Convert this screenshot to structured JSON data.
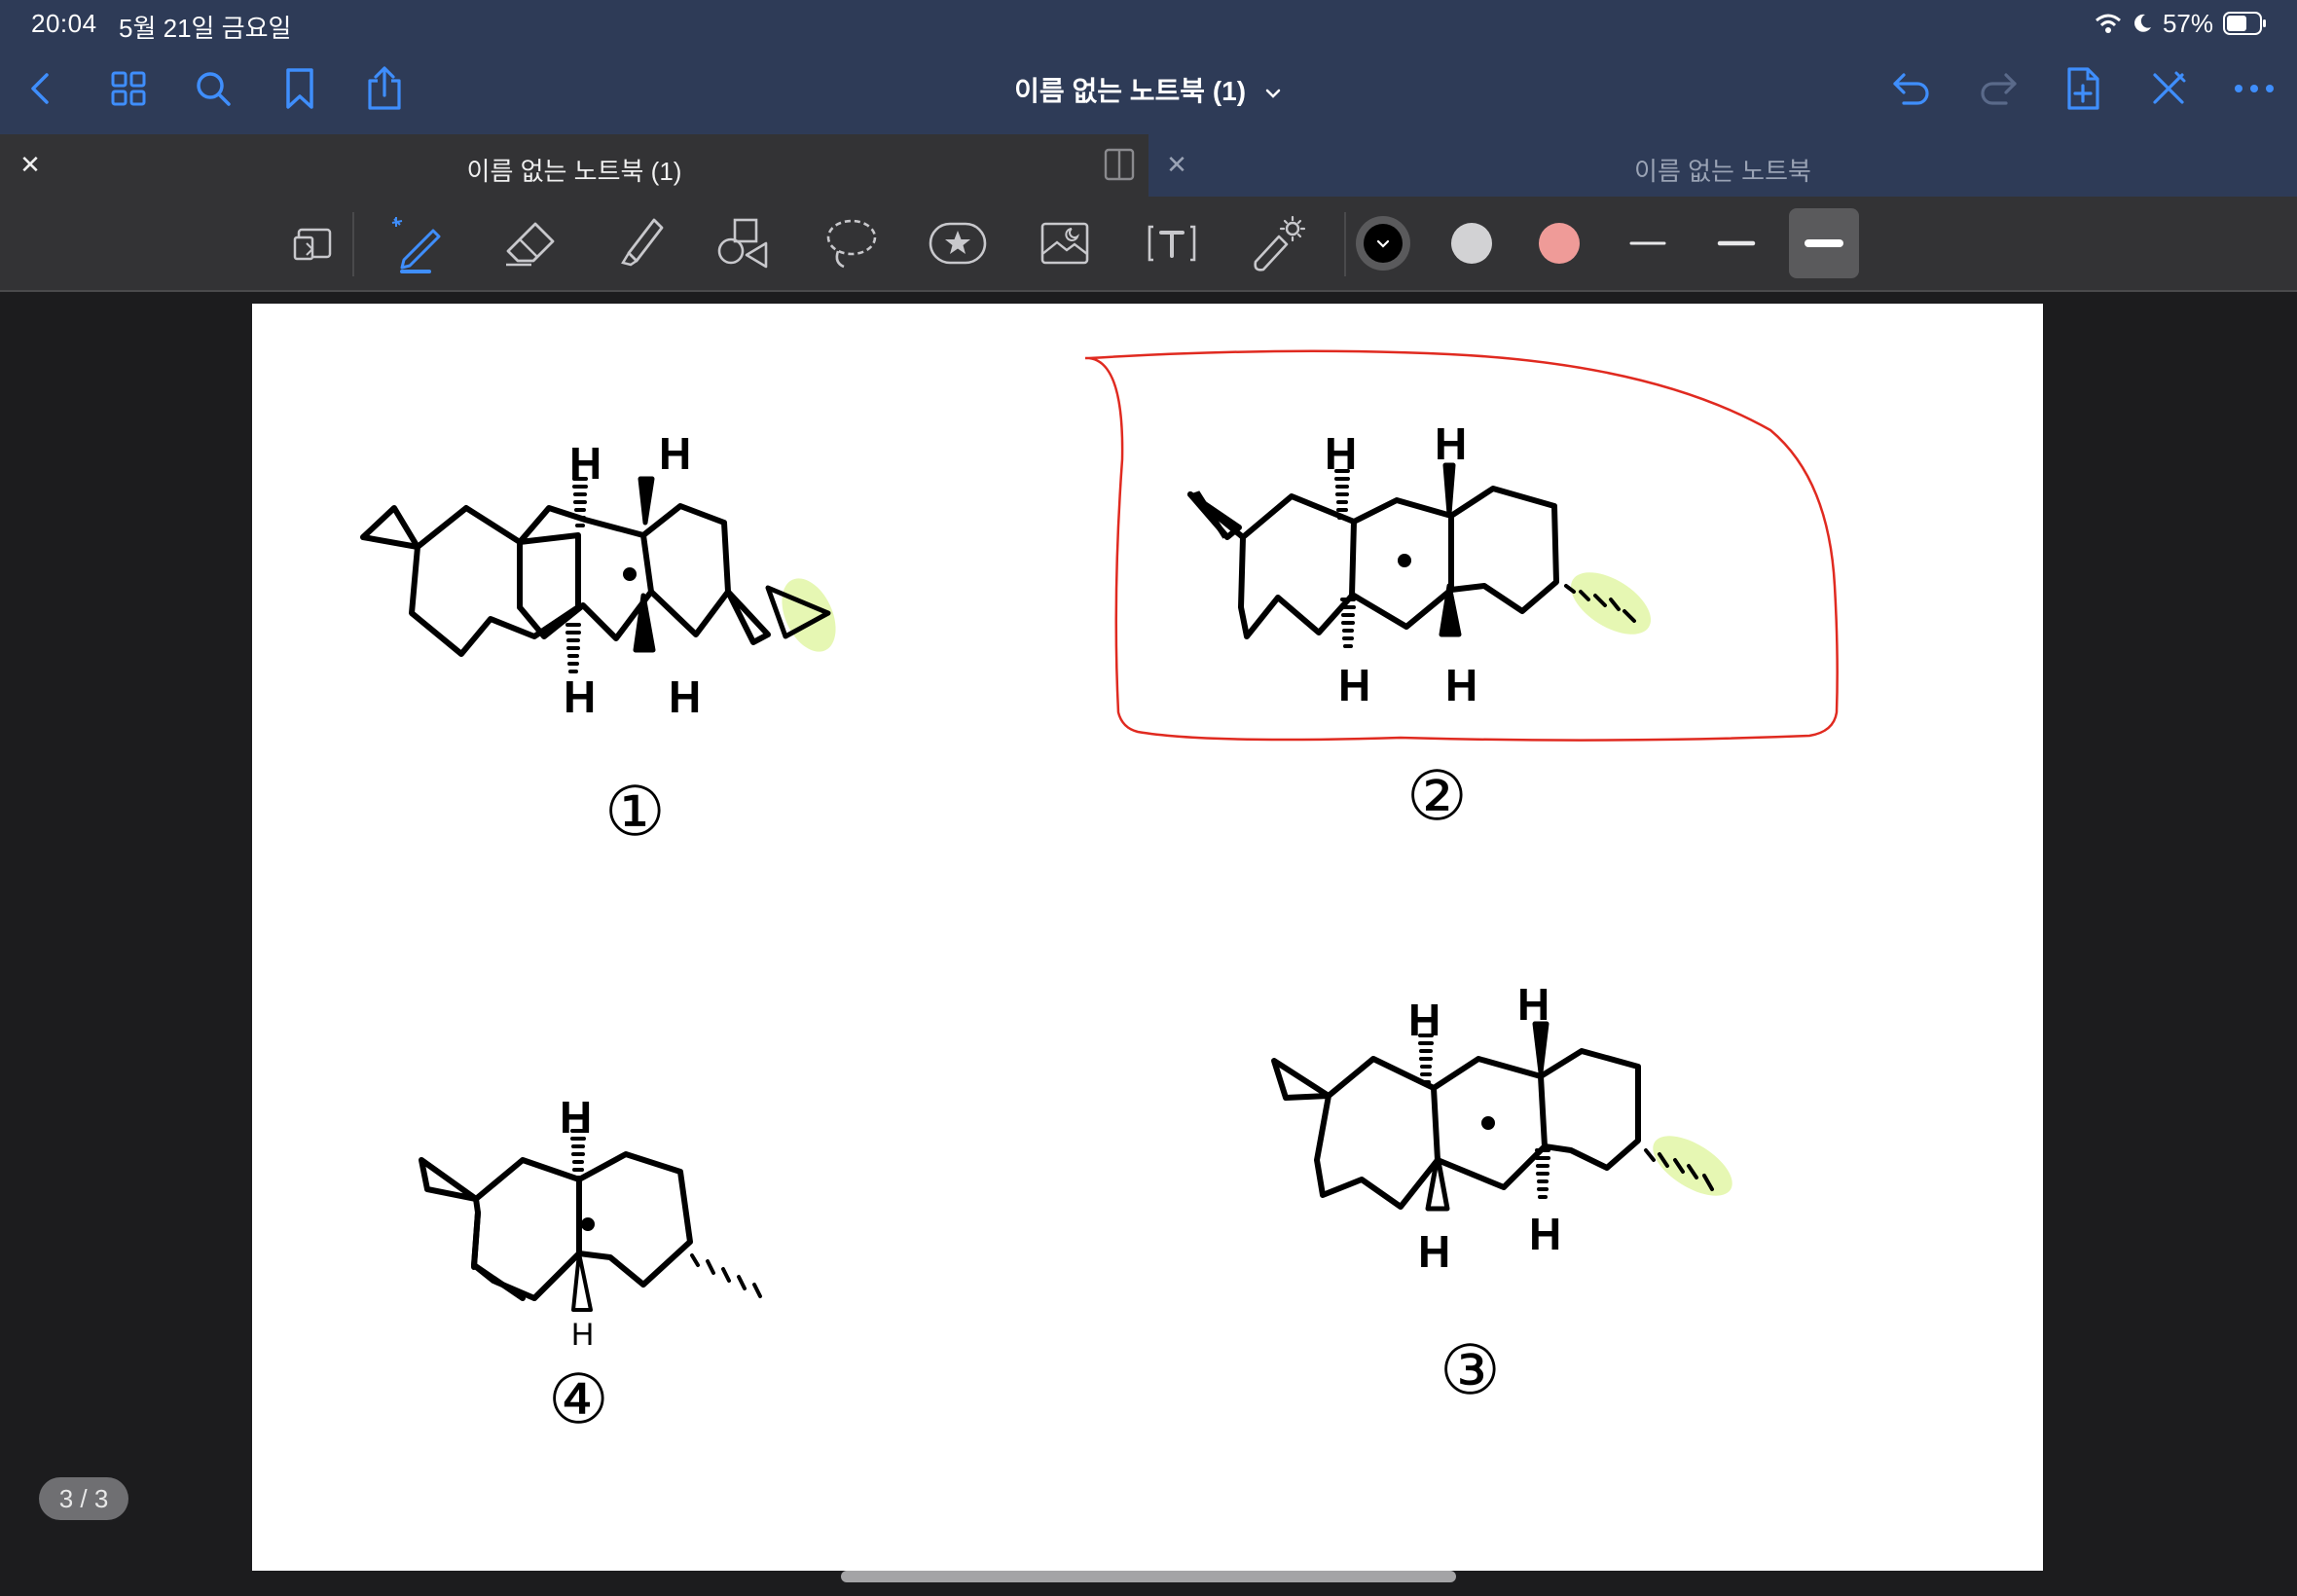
{
  "status_bar": {
    "time": "20:04",
    "date": "5월 21일 금요일",
    "battery": "57%"
  },
  "nav": {
    "title": "이름 없는 노트북 (1)",
    "left_icons": [
      "back-icon",
      "grid-icon",
      "search-icon",
      "bookmark-icon",
      "share-icon"
    ],
    "right_icons": [
      "undo-icon",
      "redo-icon",
      "add-page-icon",
      "close-pen-icon",
      "more-icon"
    ]
  },
  "tabs": [
    {
      "label": "이름 없는 노트북 (1)",
      "active": true
    },
    {
      "label": "이름 없는 노트북",
      "active": false
    }
  ],
  "toolbar": {
    "tools": [
      "page-switch-icon",
      "pen-icon",
      "eraser-icon",
      "highlighter-icon",
      "shapes-icon",
      "lasso-icon",
      "sticker-icon",
      "image-icon",
      "text-icon",
      "laser-pointer-icon"
    ],
    "colors": [
      "#000000",
      "#d2d2d4",
      "#ef9b98"
    ],
    "active_tool": "pen-icon"
  },
  "page_indicator": "3 / 3",
  "page": {
    "molecule_1_hydrogens": [
      "H",
      "H",
      "H",
      "H"
    ],
    "molecule_2_hydrogens": [
      "H",
      "H",
      "H",
      "H"
    ],
    "molecule_3_hydrogens": [
      "H",
      "H",
      "H",
      "H"
    ],
    "molecule_4_hydrogens": [
      "H",
      "H"
    ],
    "labels": [
      "①",
      "②",
      "③",
      "④"
    ]
  },
  "accent_color": "#3f8efc",
  "highlight_color": "#e6f7b3",
  "ink_red": "#e02a20"
}
